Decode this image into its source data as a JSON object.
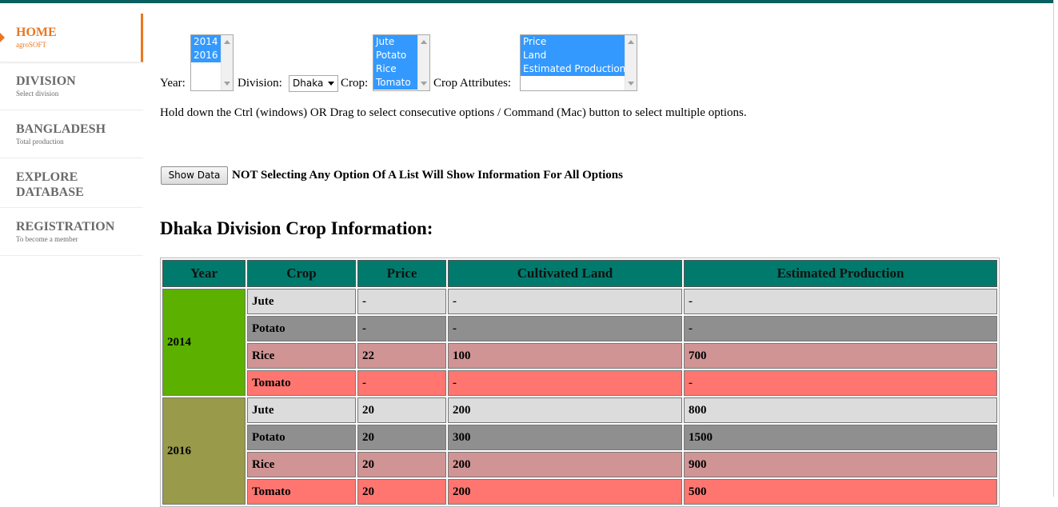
{
  "sidebar": {
    "items": [
      {
        "title": "HOME",
        "sub": "agroSOFT"
      },
      {
        "title": "DIVISION",
        "sub": "Select division"
      },
      {
        "title": "BANGLADESH",
        "sub": "Total production"
      },
      {
        "title": "EXPLORE DATABASE",
        "sub": ""
      },
      {
        "title": "REGISTRATION",
        "sub": "To become a member"
      }
    ]
  },
  "form": {
    "year_label": "Year:",
    "year_options": [
      "2014",
      "2016"
    ],
    "division_label": "Division:",
    "division_value": "Dhaka",
    "crop_label": "Crop:",
    "crop_options": [
      "Jute",
      "Potato",
      "Rice",
      "Tomato"
    ],
    "attr_label": "Crop Attributes:",
    "attr_options": [
      "Price",
      "Land",
      "Estimated Production"
    ],
    "hint": "Hold down the Ctrl (windows) OR Drag to select consecutive options / Command (Mac) button to select multiple options.",
    "show_button": "Show Data",
    "note": "NOT Selecting Any Option Of A List Will Show Information For All Options"
  },
  "heading": "Dhaka Division Crop Information:",
  "table": {
    "headers": [
      "Year",
      "Crop",
      "Price",
      "Cultivated Land",
      "Estimated Production"
    ],
    "groups": [
      {
        "year": "2014",
        "rows": [
          {
            "crop": "Jute",
            "price": "-",
            "land": "-",
            "prod": "-"
          },
          {
            "crop": "Potato",
            "price": "-",
            "land": "-",
            "prod": "-"
          },
          {
            "crop": "Rice",
            "price": "22",
            "land": "100",
            "prod": "700"
          },
          {
            "crop": "Tomato",
            "price": "-",
            "land": "-",
            "prod": "-"
          }
        ]
      },
      {
        "year": "2016",
        "rows": [
          {
            "crop": "Jute",
            "price": "20",
            "land": "200",
            "prod": "800"
          },
          {
            "crop": "Potato",
            "price": "20",
            "land": "300",
            "prod": "1500"
          },
          {
            "crop": "Rice",
            "price": "20",
            "land": "200",
            "prod": "900"
          },
          {
            "crop": "Tomato",
            "price": "20",
            "land": "200",
            "prod": "500"
          }
        ]
      }
    ]
  },
  "colors": {
    "header": "#007a6c",
    "year_2014": "#5cb000",
    "year_2016": "#999a4a",
    "accent": "#e87722"
  }
}
